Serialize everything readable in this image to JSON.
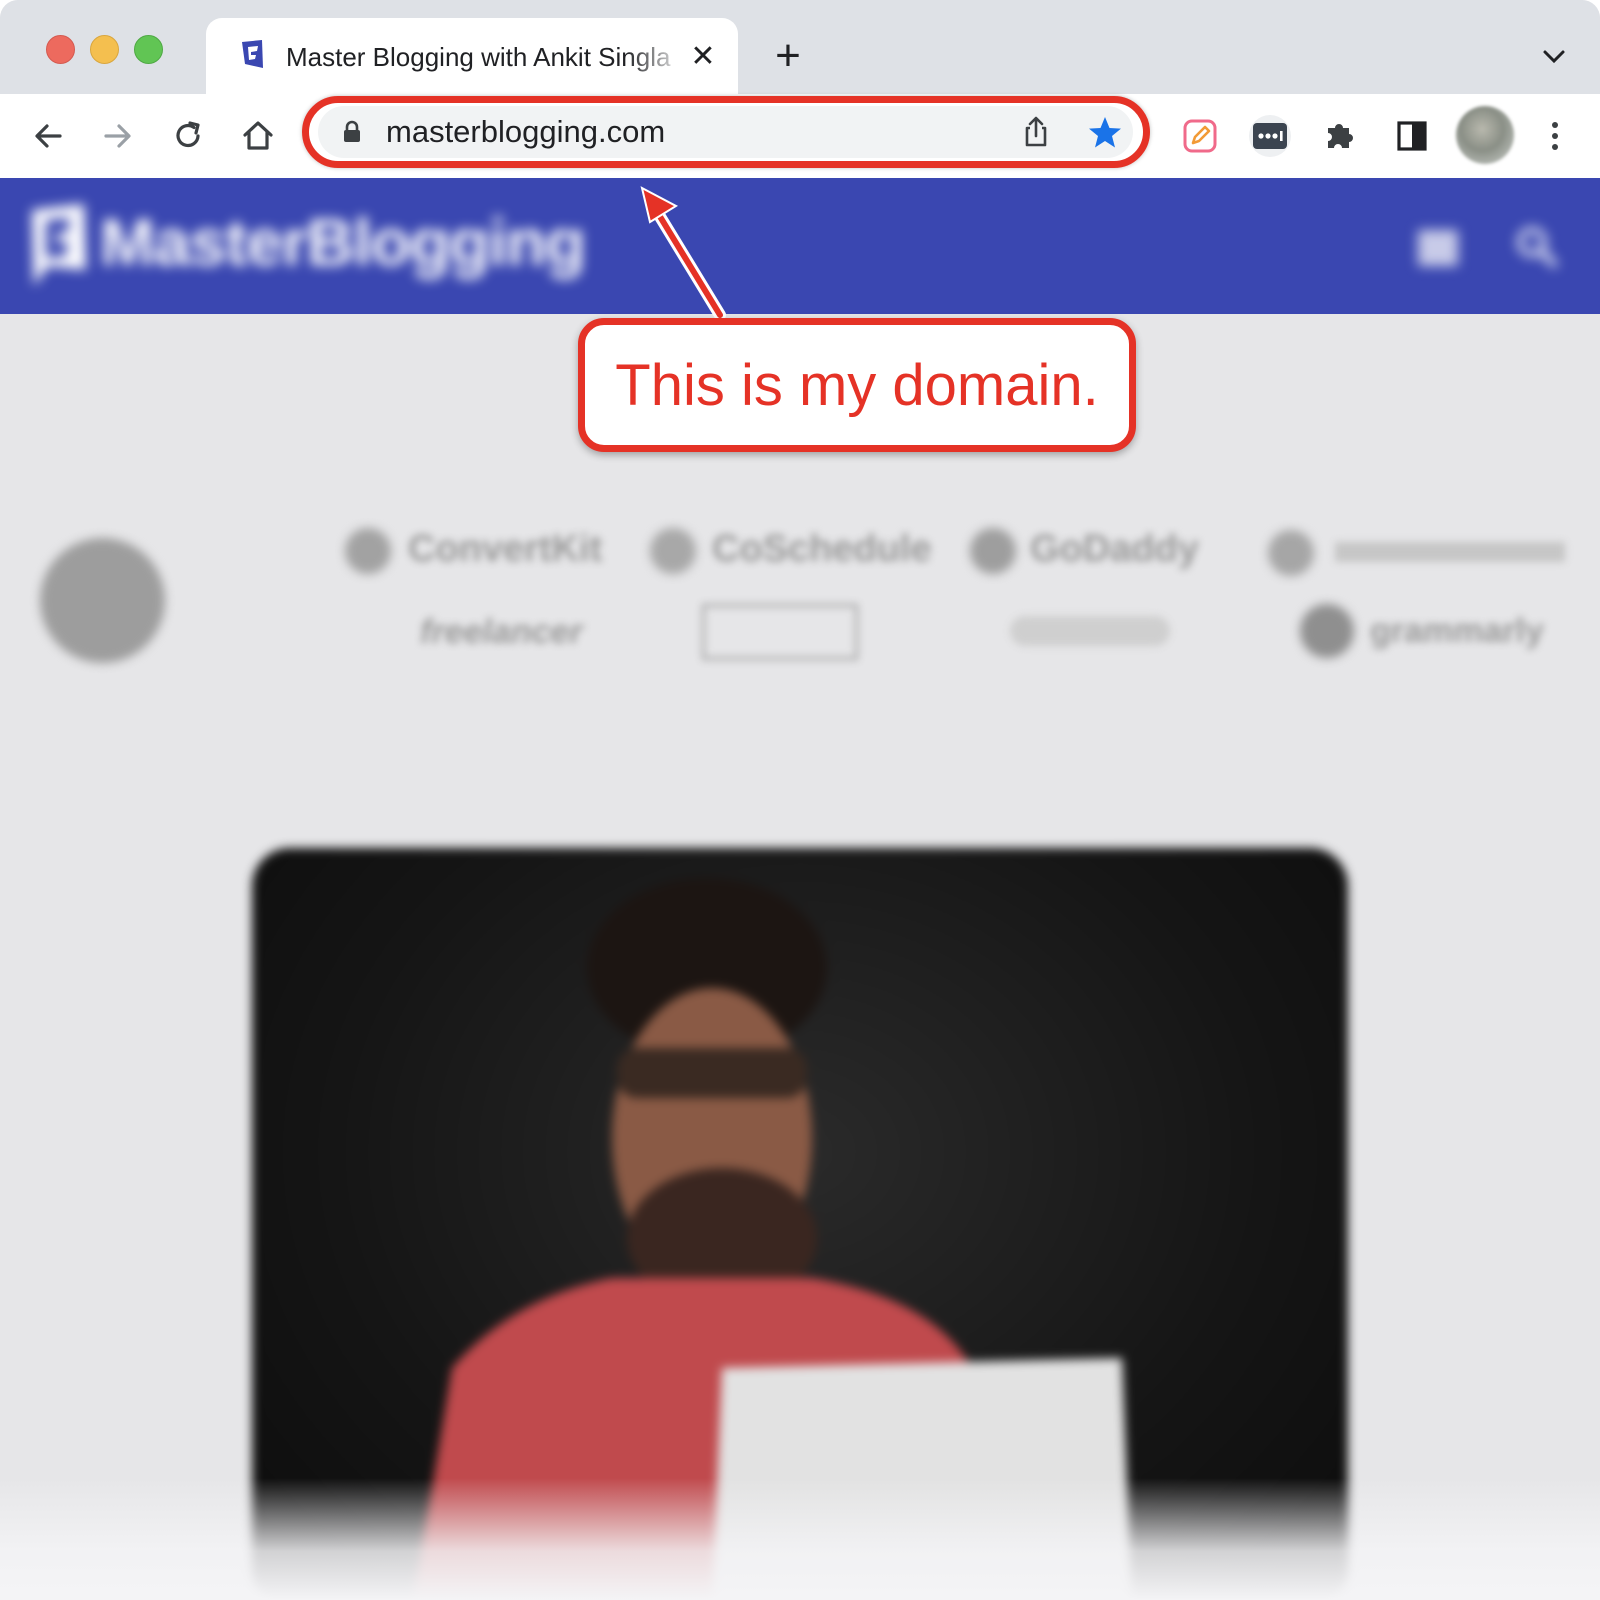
{
  "browser": {
    "tab": {
      "title": "Master Blogging with Ankit Singla",
      "close_glyph": "✕"
    },
    "new_tab_glyph": "+",
    "address_bar": {
      "url": "masterblogging.com"
    },
    "colors": {
      "accent": "#1a73e8",
      "annotation": "#e53226"
    }
  },
  "site": {
    "logo_text": "MasterBlogging",
    "header_color": "#3a47b1",
    "partner_logos": [
      "ConvertKit",
      "CoSchedule",
      "GoDaddy",
      "freelancer",
      "grammarly"
    ]
  },
  "annotation": {
    "text": "This is my domain."
  }
}
